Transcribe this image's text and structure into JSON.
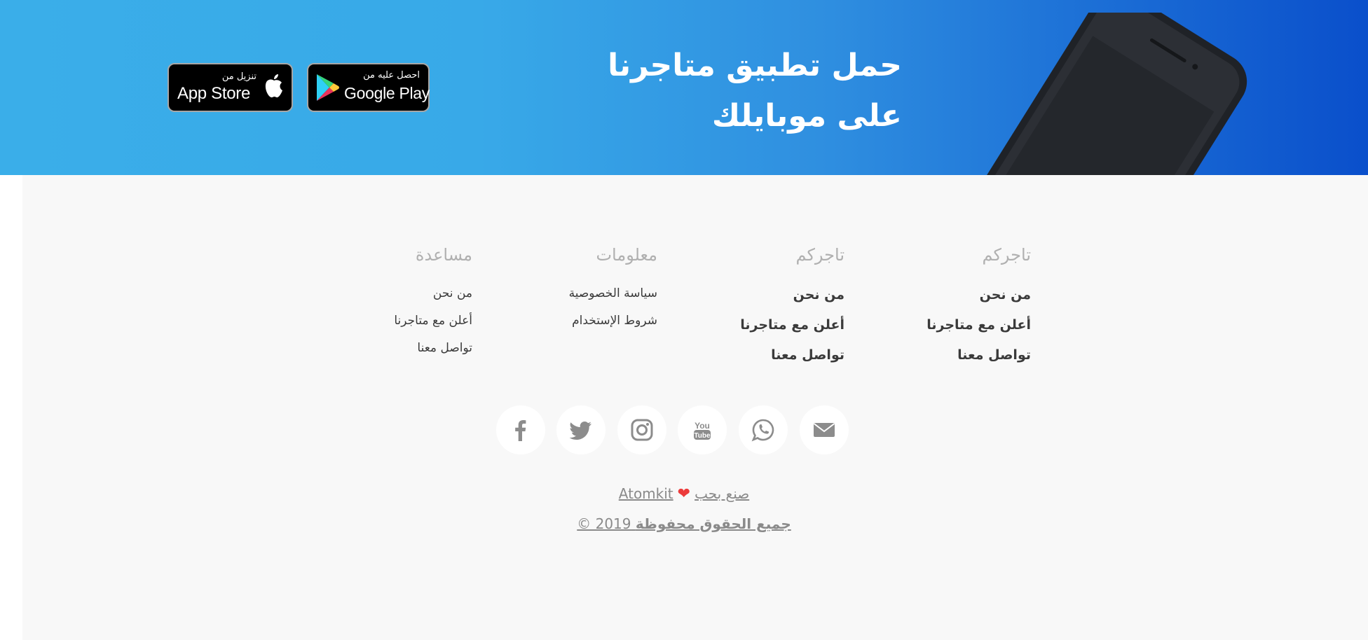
{
  "banner": {
    "headline_line1": "حمل تطبيق متاجرنا",
    "headline_line2": "على موبايلك",
    "google_play": {
      "small": "احصل عليه من",
      "big": "Google Play"
    },
    "app_store": {
      "small": "تنزيل من",
      "big": "App Store"
    },
    "colors": {
      "gradient_start": "#3aaee9",
      "gradient_end": "#0a4fcb",
      "button_bg": "#000000"
    }
  },
  "footer": {
    "columns": [
      {
        "title": "تاجركم",
        "links": [
          "من نحن",
          "أعلن مع متاجرنا",
          "تواصل معنا"
        ]
      },
      {
        "title": "تاجركم",
        "links": [
          "من نحن",
          "أعلن مع متاجرنا",
          "تواصل معنا"
        ]
      },
      {
        "title": "معلومات",
        "links": [
          "سياسة الخصوصية",
          "شروط الإستخدام"
        ]
      },
      {
        "title": "مساعدة",
        "links": [
          "من نحن",
          "أعلن مع متاجرنا",
          "تواصل معنا"
        ]
      }
    ],
    "social_icons": [
      "email-icon",
      "whatsapp-icon",
      "youtube-icon",
      "instagram-icon",
      "twitter-icon",
      "facebook-icon"
    ],
    "credit": {
      "text": "صنع بحب",
      "brand": "Atomkit"
    },
    "copyright": {
      "text": "جميع الحقوق محفوظة",
      "year": "© 2019"
    },
    "colors": {
      "background": "#f8f8f8",
      "icon": "#8c8c8c",
      "heart": "#ec3b3b"
    }
  }
}
